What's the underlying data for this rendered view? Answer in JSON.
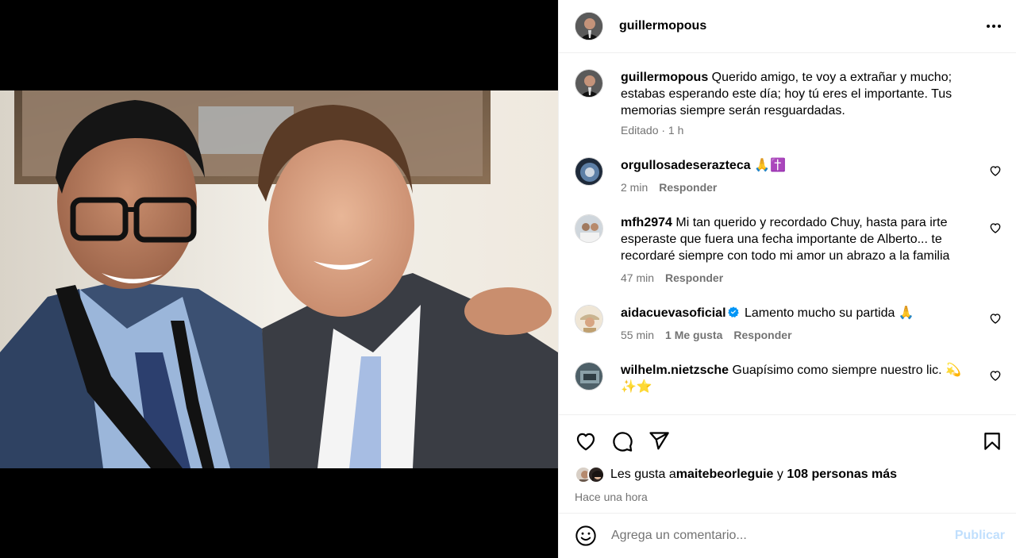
{
  "post": {
    "username": "guillermopous",
    "caption_user": "guillermopous",
    "caption_text": " Querido amigo, te voy a extrañar y mucho; estabas esperando este día; hoy tú eres el importante. Tus memorias siempre serán resguardadas.",
    "caption_meta": "Editado · 1 h"
  },
  "comments": [
    {
      "user": "orgullosadeserazteca",
      "text": " 🙏✝️",
      "time": "2 min",
      "likes": "",
      "reply": "Responder",
      "verified": false
    },
    {
      "user": "mfh2974",
      "text": " Mi tan querido y recordado Chuy, hasta para irte esperaste que fuera una fecha importante de Alberto... te recordaré siempre con todo mi amor un abrazo a la familia",
      "time": "47 min",
      "likes": "",
      "reply": "Responder",
      "verified": false
    },
    {
      "user": "aidacuevasoficial",
      "text": " Lamento mucho su partida 🙏",
      "time": "55 min",
      "likes": "1 Me gusta",
      "reply": "Responder",
      "verified": true
    },
    {
      "user": "wilhelm.nietzsche",
      "text": " Guapísimo como siempre nuestro lic. 💫✨⭐",
      "time": "",
      "likes": "",
      "reply": "",
      "verified": false
    }
  ],
  "likes_line": {
    "prefix": "Les gusta a ",
    "user": "maitebeorleguie",
    "mid": " y ",
    "others": "108 personas más"
  },
  "posted_time": "Hace una hora",
  "comment_box": {
    "placeholder": "Agrega un comentario...",
    "publish_label": "Publicar"
  },
  "icons": {
    "more": "more-horizontal-icon",
    "like": "heart-icon",
    "comment": "comment-icon",
    "share": "send-icon",
    "save": "bookmark-icon",
    "emoji": "emoji-icon"
  },
  "colors": {
    "verified": "#0095f6",
    "publish_disabled": "#c0dffd",
    "secondary_text": "#737373"
  }
}
